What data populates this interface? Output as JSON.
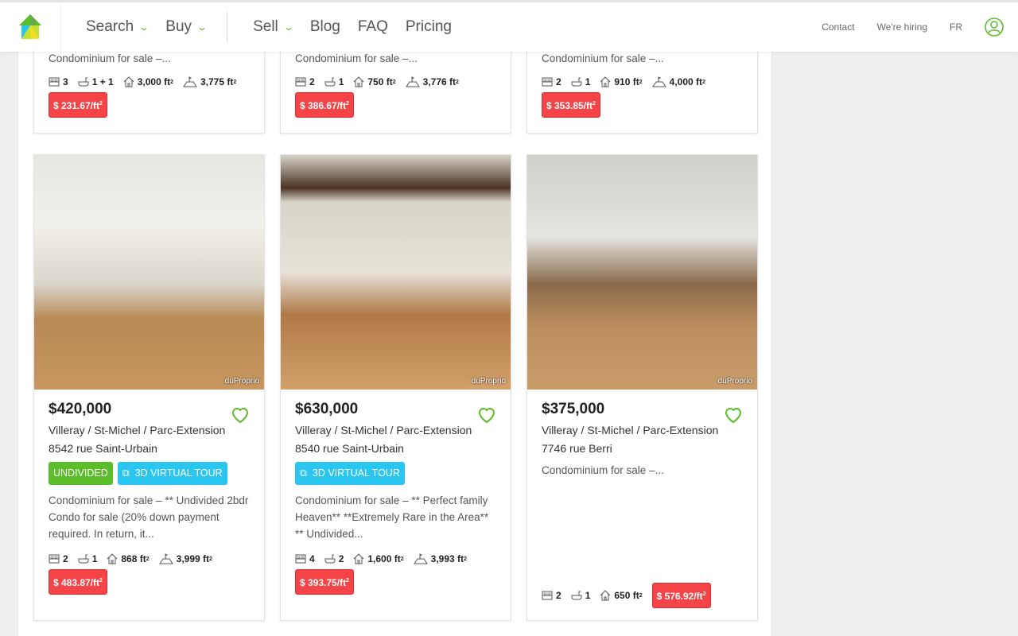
{
  "header": {
    "nav": [
      {
        "label": "Search",
        "dropdown": true
      },
      {
        "label": "Buy",
        "dropdown": true
      },
      {
        "label": "Sell",
        "dropdown": true
      },
      {
        "label": "Blog"
      },
      {
        "label": "FAQ"
      },
      {
        "label": "Pricing"
      }
    ],
    "right": [
      "Contact",
      "We're hiring",
      "FR"
    ],
    "icons": {
      "logo": "house-logo",
      "user": "user-circle-icon"
    }
  },
  "colors": {
    "accent": "#5bbd2a",
    "virtual_tour": "#2ac6f0",
    "price_badge": "#f44447"
  },
  "unit": "ft",
  "top_cards": [
    {
      "desc": "Condominium for sale –...",
      "beds": "3",
      "baths": "1 + 1",
      "living": "3,000 ft",
      "lot": "3,775 ft",
      "ppsf": "$ 231.67/ft"
    },
    {
      "desc": "Condominium for sale –...",
      "beds": "2",
      "baths": "1",
      "living": "750 ft",
      "lot": "3,776 ft",
      "ppsf": "$ 386.67/ft"
    },
    {
      "desc": "Condominium for sale –...",
      "beds": "2",
      "baths": "1",
      "living": "910 ft",
      "lot": "4,000 ft",
      "ppsf": "$ 353.85/ft"
    }
  ],
  "cards": [
    {
      "price": "$420,000",
      "area": "Villeray / St-Michel / Parc-Extension",
      "address": "8542 rue Saint-Urbain",
      "tags": [
        "UNDIVIDED",
        "3D VIRTUAL TOUR"
      ],
      "desc": "Condominium for sale – ** Undivided 2bdr Condo for sale (20% down payment required. In return, it...",
      "beds": "2",
      "baths": "1",
      "living": "868 ft",
      "lot": "3,999 ft",
      "ppsf": "$ 483.87/ft",
      "watermark": "duProprio"
    },
    {
      "price": "$630,000",
      "area": "Villeray / St-Michel / Parc-Extension",
      "address": "8540 rue Saint-Urbain",
      "tags": [
        "3D VIRTUAL TOUR"
      ],
      "desc": "Condominium for sale – ** Perfect family Heaven** **Extremely Rare in the Area** ** Undivided...",
      "beds": "4",
      "baths": "2",
      "living": "1,600 ft",
      "lot": "3,993 ft",
      "ppsf": "$ 393.75/ft",
      "watermark": "duProprio"
    },
    {
      "price": "$375,000",
      "area": "Villeray / St-Michel / Parc-Extension",
      "address": "7746 rue Berri",
      "tags": [],
      "desc": "Condominium for sale –...",
      "beds": "2",
      "baths": "1",
      "living": "650 ft",
      "ppsf": "$ 576.92/ft",
      "watermark": "duProprio"
    }
  ]
}
